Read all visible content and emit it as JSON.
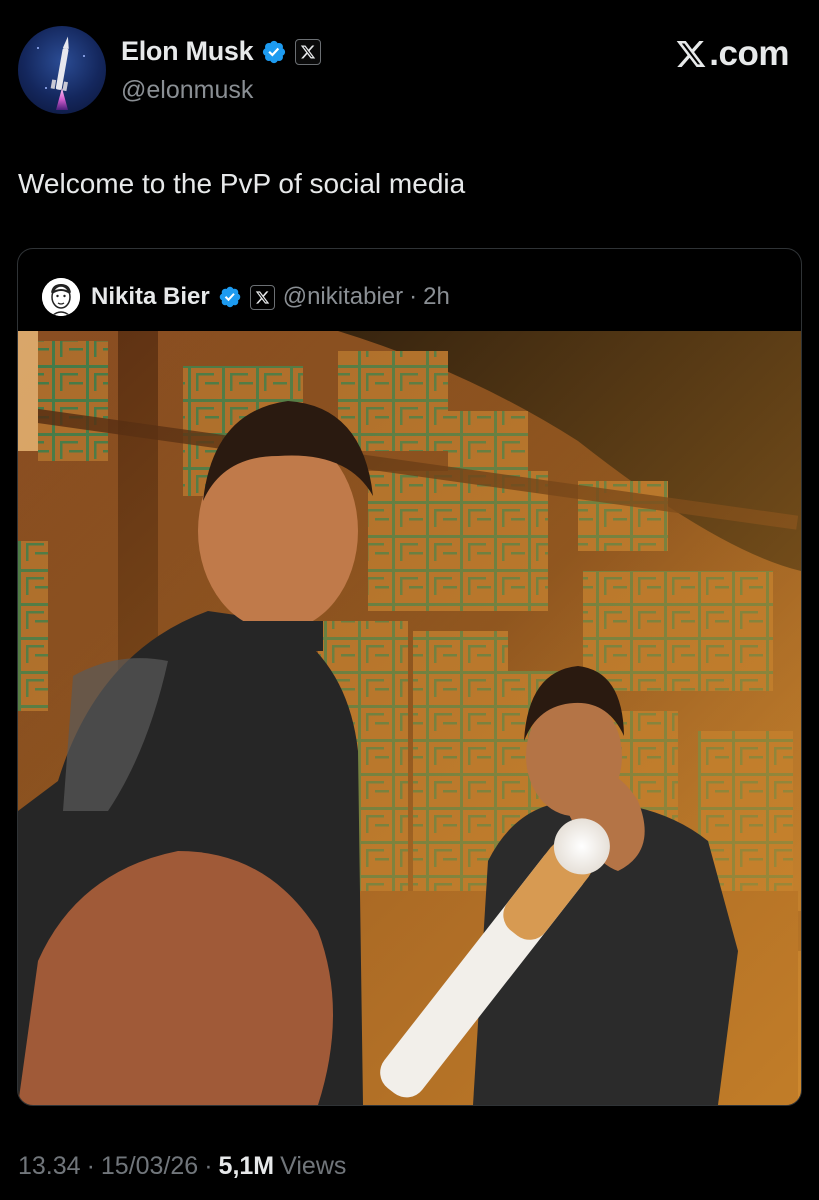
{
  "author": {
    "name": "Elon Musk",
    "handle": "@elonmusk",
    "avatar_icon": "rocket-avatar",
    "verified_color": "#1d9bf0"
  },
  "brand": {
    "site": ".com"
  },
  "tweet": {
    "text": "Welcome to the PvP of social media"
  },
  "quoted": {
    "name": "Nikita Bier",
    "handle": "@nikitabier",
    "separator": "·",
    "time": "2h",
    "avatar_icon": "cartoon-face-avatar"
  },
  "meta": {
    "time": "13.34",
    "sep1": "·",
    "date": "15/03/26",
    "sep2": "·",
    "views_count": "5,1M",
    "views_label": "Views"
  }
}
